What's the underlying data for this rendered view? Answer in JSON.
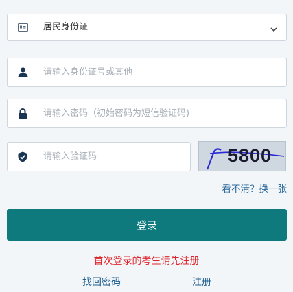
{
  "id_type": {
    "selected": "居民身份证",
    "icon": "id-card-icon"
  },
  "username": {
    "placeholder": "请输入身份证号或其他",
    "icon": "user-icon"
  },
  "password": {
    "placeholder": "请输入密码（初始密码为短信验证码)",
    "icon": "lock-icon"
  },
  "captcha": {
    "placeholder": "请输入验证码",
    "icon": "shield-check-icon",
    "code": "5800",
    "refresh_label": "看不清？换一张"
  },
  "login_button": "登录",
  "register_notice": "首次登录的考生请先注册",
  "links": {
    "forgot": "找回密码",
    "register": "注册"
  },
  "colors": {
    "primary": "#0f7a7e",
    "icon": "#1a3552",
    "notice": "#e0262d",
    "link": "#1d5e8f"
  }
}
